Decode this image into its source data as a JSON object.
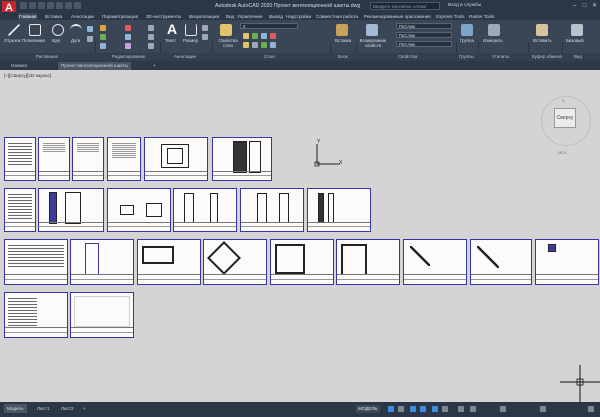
{
  "app": {
    "title": "Autodesk AutoCAD 2020   Проект вентиляционной шахты.dwg",
    "logo_letter": "A",
    "search_placeholder": "Введите ключевое слово/фразу",
    "login": "Вход в службы",
    "window_controls": [
      "–",
      "□",
      "✕"
    ]
  },
  "ribbon": {
    "tabs": [
      "Главная",
      "Вставка",
      "Аннотации",
      "Параметризация",
      "3D-инструменты",
      "Визуализация",
      "Вид",
      "Управление",
      "Вывод",
      "Надстройки",
      "Совместная работа",
      "Рекомендованные приложения",
      "Express Tools",
      "Raster Tools"
    ],
    "active_tab": 0,
    "buttons": {
      "line": "Отрезок",
      "polyline": "Полилиния",
      "circle": "Круг",
      "arc": "Дуга",
      "text": "Текст",
      "dimension": "Размер",
      "layer_props": "Свойства слоя",
      "insert": "Вставка",
      "match_props": "Копирование свойств",
      "group": "Группа",
      "measure": "Измерить",
      "paste": "Вставить",
      "base": "Базовый"
    },
    "combos": {
      "layer": "0",
      "color": "ПоСлою",
      "linetype": "ПоСлою",
      "lineweight": "ПоСлою"
    },
    "panels": [
      "Рисование",
      "Редактирование",
      "Аннотации",
      "Слои",
      "Блок",
      "Свойства",
      "Группы",
      "Утилиты",
      "Буфер обмена",
      "Вид"
    ]
  },
  "file_tabs": [
    "Начало",
    "Проект вентиляционной шахты",
    "+"
  ],
  "active_file_tab": 1,
  "viewport_label": "[–][Сверху][2D-каркас]",
  "viewcube": {
    "face": "Сверху",
    "north": "С",
    "wcs": "МСК"
  },
  "ucs": {
    "x": "X",
    "y": "Y"
  },
  "status": {
    "layout_tabs": [
      "Модель",
      "Лист1",
      "Лист2",
      "+"
    ],
    "active_layout": 0,
    "model_button": "МОДЕЛЬ",
    "icons": [
      "grid-icon",
      "snap-icon",
      "ortho-icon",
      "polar-icon",
      "osnap-icon",
      "otrack-icon",
      "lineweight-icon",
      "transparency-icon",
      "annotation-scale-icon",
      "workspace-icon",
      "customize-icon"
    ]
  },
  "colors": {
    "titlebar": "#2b3646",
    "ribbon": "#3a4556",
    "canvas": "#d4d4d4",
    "sheet_border": "#3535a8",
    "logo": "#c8242b"
  }
}
